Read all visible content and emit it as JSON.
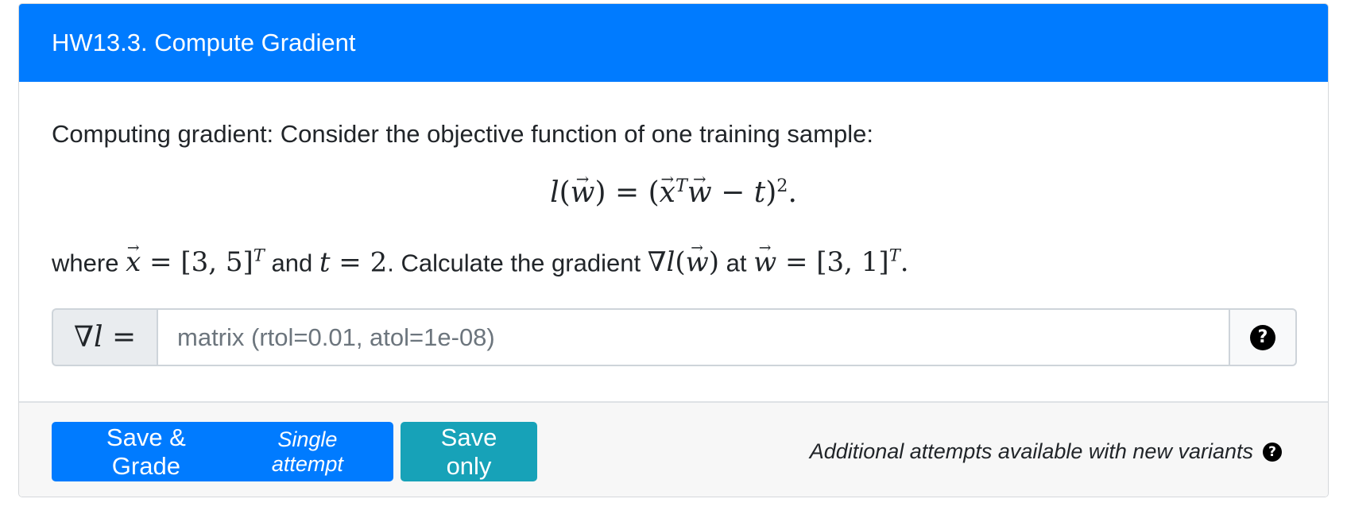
{
  "header": {
    "title": "HW13.3. Compute Gradient"
  },
  "question": {
    "intro": "Computing gradient: Consider the objective function of one training sample:",
    "equation": {
      "lhs_fn": "l",
      "lhs_arg": "w",
      "eq": "=",
      "open": "(",
      "x": "x",
      "sup_T": "T",
      "w": "w",
      "minus": "−",
      "t": "t",
      "close": ")",
      "sup_2": "2",
      "end": "."
    },
    "sentence": {
      "where": "where",
      "x_value": "[3, 5]",
      "and": "and",
      "t_value": "2",
      "calc": ". Calculate the gradient",
      "nabla": "∇",
      "at": "at",
      "w_value": "[3, 1]"
    }
  },
  "answer": {
    "label_nabla": "∇",
    "label_l": "l",
    "label_eq": "=",
    "placeholder": "matrix (rtol=0.01, atol=1e-08)",
    "help_icon": "?"
  },
  "footer": {
    "grade_button": "Save & Grade",
    "grade_note": "Single attempt",
    "save_button": "Save only",
    "attempts_text": "Additional attempts available with new variants",
    "help_icon": "?"
  }
}
